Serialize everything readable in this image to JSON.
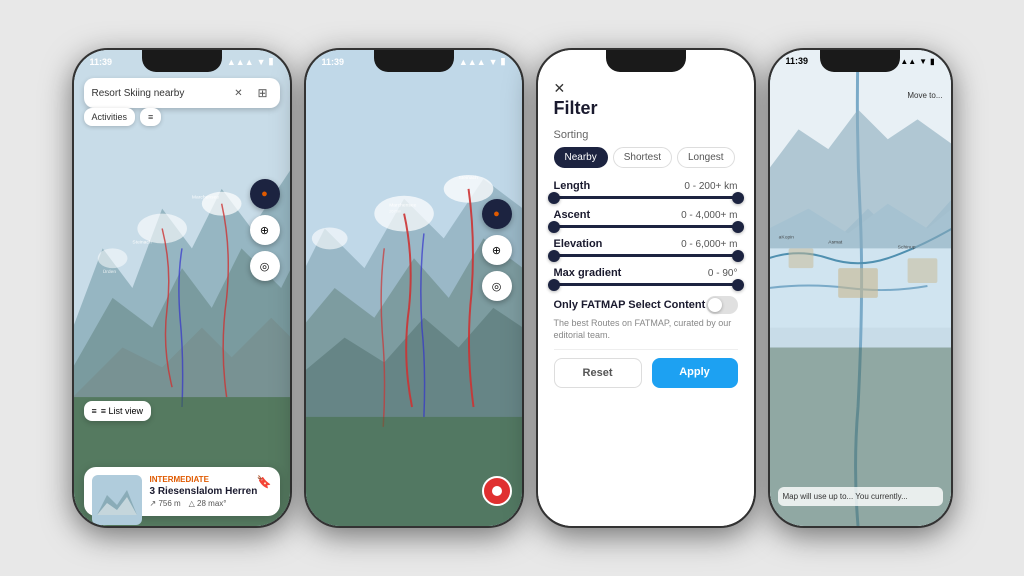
{
  "phones": [
    {
      "id": "phone1",
      "type": "map",
      "statusBar": {
        "time": "11:39",
        "icons": "●●▲"
      },
      "search": {
        "text": "Resort Skiing nearby",
        "placeholder": "Resort Skiing nearby"
      },
      "filters": [
        {
          "label": "Activities"
        },
        {
          "label": "≡"
        }
      ],
      "mapButtons": [
        "🧭",
        "⊕",
        "◎"
      ],
      "listViewLabel": "≡  List view",
      "card": {
        "badge": "INTERMEDIATE",
        "title": "3 Riesenslalom Herren",
        "distance": "756 m",
        "gradient": "28 max°"
      }
    },
    {
      "id": "phone2",
      "type": "map2",
      "statusBar": {
        "time": "11:39"
      }
    },
    {
      "id": "phone3",
      "type": "filter",
      "statusBar": {
        "time": "11:39"
      },
      "filter": {
        "title": "Filter",
        "sorting": {
          "label": "Sorting",
          "options": [
            {
              "label": "Nearby",
              "active": true
            },
            {
              "label": "Shortest",
              "active": false
            },
            {
              "label": "Longest",
              "active": false
            }
          ]
        },
        "sliders": [
          {
            "label": "Length",
            "value": "0 - 200+ km"
          },
          {
            "label": "Ascent",
            "value": "0 - 4,000+ m"
          },
          {
            "label": "Elevation",
            "value": "0 - 6,000+ m"
          },
          {
            "label": "Max gradient",
            "value": "0 - 90°"
          }
        ],
        "toggle": {
          "label": "Only FATMAP Select Content",
          "description": "The best Routes on FATMAP, curated by our editorial team.",
          "enabled": false
        },
        "buttons": {
          "reset": "Reset",
          "apply": "Apply"
        }
      }
    },
    {
      "id": "phone4",
      "type": "map3",
      "statusBar": {
        "time": "11:39"
      },
      "overlayText": "Move to..."
    }
  ]
}
